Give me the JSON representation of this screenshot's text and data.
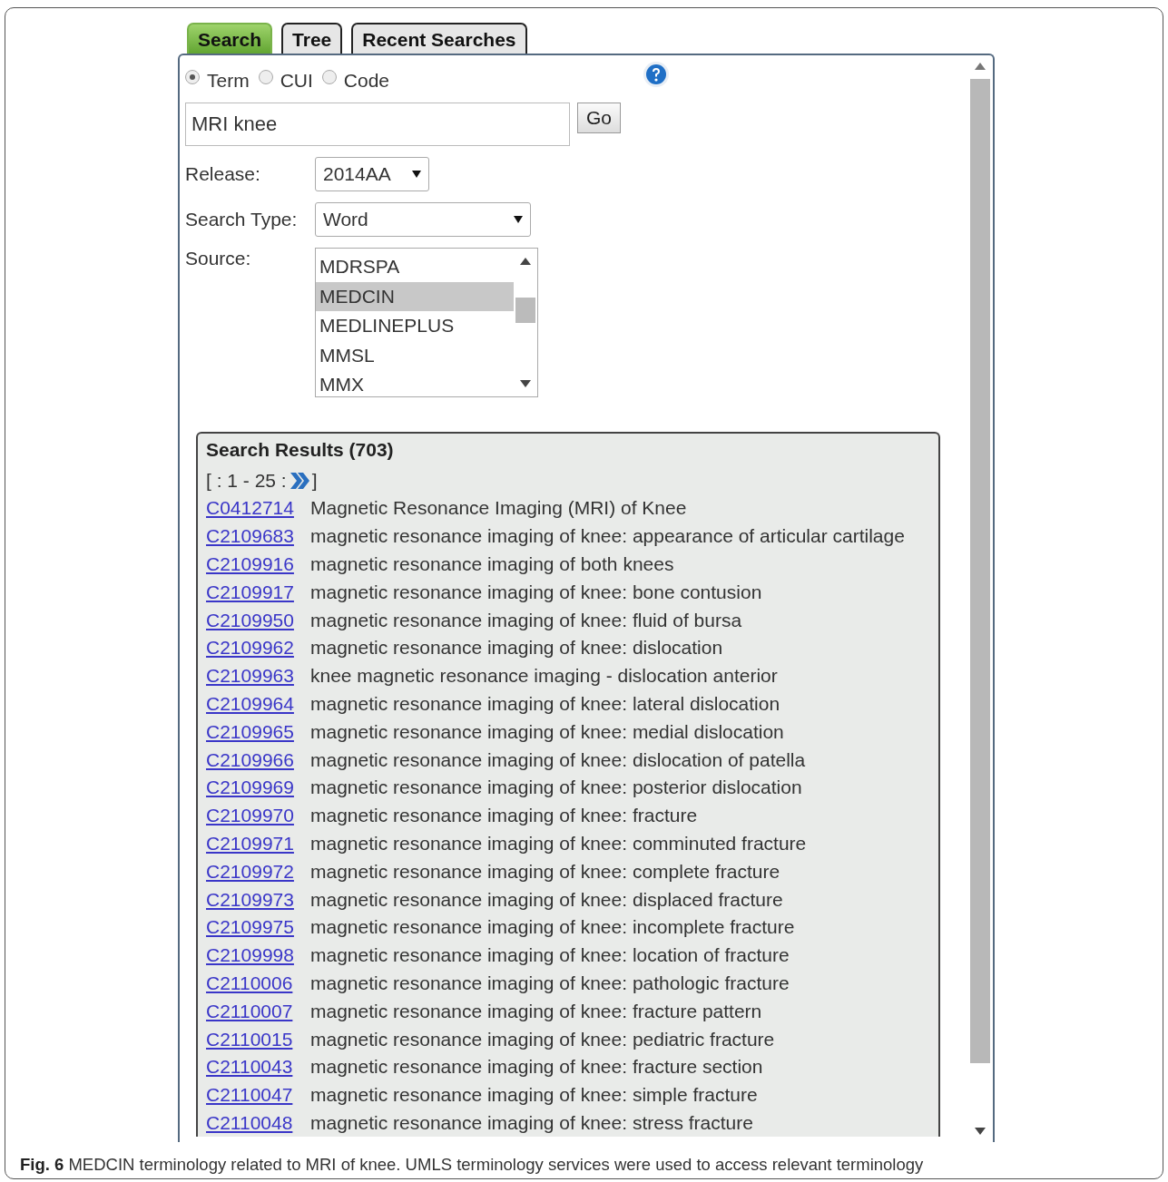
{
  "tabs": [
    {
      "label": "Search",
      "selected": true
    },
    {
      "label": "Tree",
      "selected": false
    },
    {
      "label": "Recent Searches",
      "selected": false
    }
  ],
  "search_by": [
    {
      "label": "Term",
      "selected": true
    },
    {
      "label": "CUI",
      "selected": false
    },
    {
      "label": "Code",
      "selected": false
    }
  ],
  "query": {
    "value": "MRI knee"
  },
  "go_button": "Go",
  "release": {
    "label": "Release:",
    "value": "2014AA"
  },
  "search_type": {
    "label": "Search Type:",
    "value": "Word"
  },
  "source": {
    "label": "Source:",
    "items": [
      {
        "label": "MDRSPA",
        "selected": false
      },
      {
        "label": "MEDCIN",
        "selected": true
      },
      {
        "label": "MEDLINEPLUS",
        "selected": false
      },
      {
        "label": "MMSL",
        "selected": false
      },
      {
        "label": "MMX",
        "selected": false
      }
    ]
  },
  "results": {
    "title": "Search Results (703)",
    "pager_prefix": "[ : 1 - 25 :",
    "pager_suffix": "]",
    "rows": [
      {
        "code": "C0412714",
        "label": "Magnetic Resonance Imaging (MRI) of Knee"
      },
      {
        "code": "C2109683",
        "label": "magnetic resonance imaging of knee: appearance of articular cartilage"
      },
      {
        "code": "C2109916",
        "label": "magnetic resonance imaging of both knees"
      },
      {
        "code": "C2109917",
        "label": "magnetic resonance imaging of knee: bone contusion"
      },
      {
        "code": "C2109950",
        "label": "magnetic resonance imaging of knee: fluid of bursa"
      },
      {
        "code": "C2109962",
        "label": "magnetic resonance imaging of knee: dislocation"
      },
      {
        "code": "C2109963",
        "label": "knee magnetic resonance imaging - dislocation anterior"
      },
      {
        "code": "C2109964",
        "label": "magnetic resonance imaging of knee: lateral dislocation"
      },
      {
        "code": "C2109965",
        "label": "magnetic resonance imaging of knee: medial dislocation"
      },
      {
        "code": "C2109966",
        "label": "magnetic resonance imaging of knee: dislocation of patella"
      },
      {
        "code": "C2109969",
        "label": "magnetic resonance imaging of knee: posterior dislocation"
      },
      {
        "code": "C2109970",
        "label": "magnetic resonance imaging of knee: fracture"
      },
      {
        "code": "C2109971",
        "label": "magnetic resonance imaging of knee: comminuted fracture"
      },
      {
        "code": "C2109972",
        "label": "magnetic resonance imaging of knee: complete fracture"
      },
      {
        "code": "C2109973",
        "label": "magnetic resonance imaging of knee: displaced fracture"
      },
      {
        "code": "C2109975",
        "label": "magnetic resonance imaging of knee: incomplete fracture"
      },
      {
        "code": "C2109998",
        "label": "magnetic resonance imaging of knee: location of fracture"
      },
      {
        "code": "C2110006",
        "label": "magnetic resonance imaging of knee: pathologic fracture"
      },
      {
        "code": "C2110007",
        "label": "magnetic resonance imaging of knee: fracture pattern"
      },
      {
        "code": "C2110015",
        "label": "magnetic resonance imaging of knee: pediatric fracture"
      },
      {
        "code": "C2110043",
        "label": "magnetic resonance imaging of knee: fracture section"
      },
      {
        "code": "C2110047",
        "label": "magnetic resonance imaging of knee: simple fracture"
      },
      {
        "code": "C2110048",
        "label": "magnetic resonance imaging of knee: stress fracture"
      }
    ]
  },
  "caption": "**Fig. 6** MEDCIN terminology related to MRI of knee. UMLS terminology services were used to access relevant terminology"
}
